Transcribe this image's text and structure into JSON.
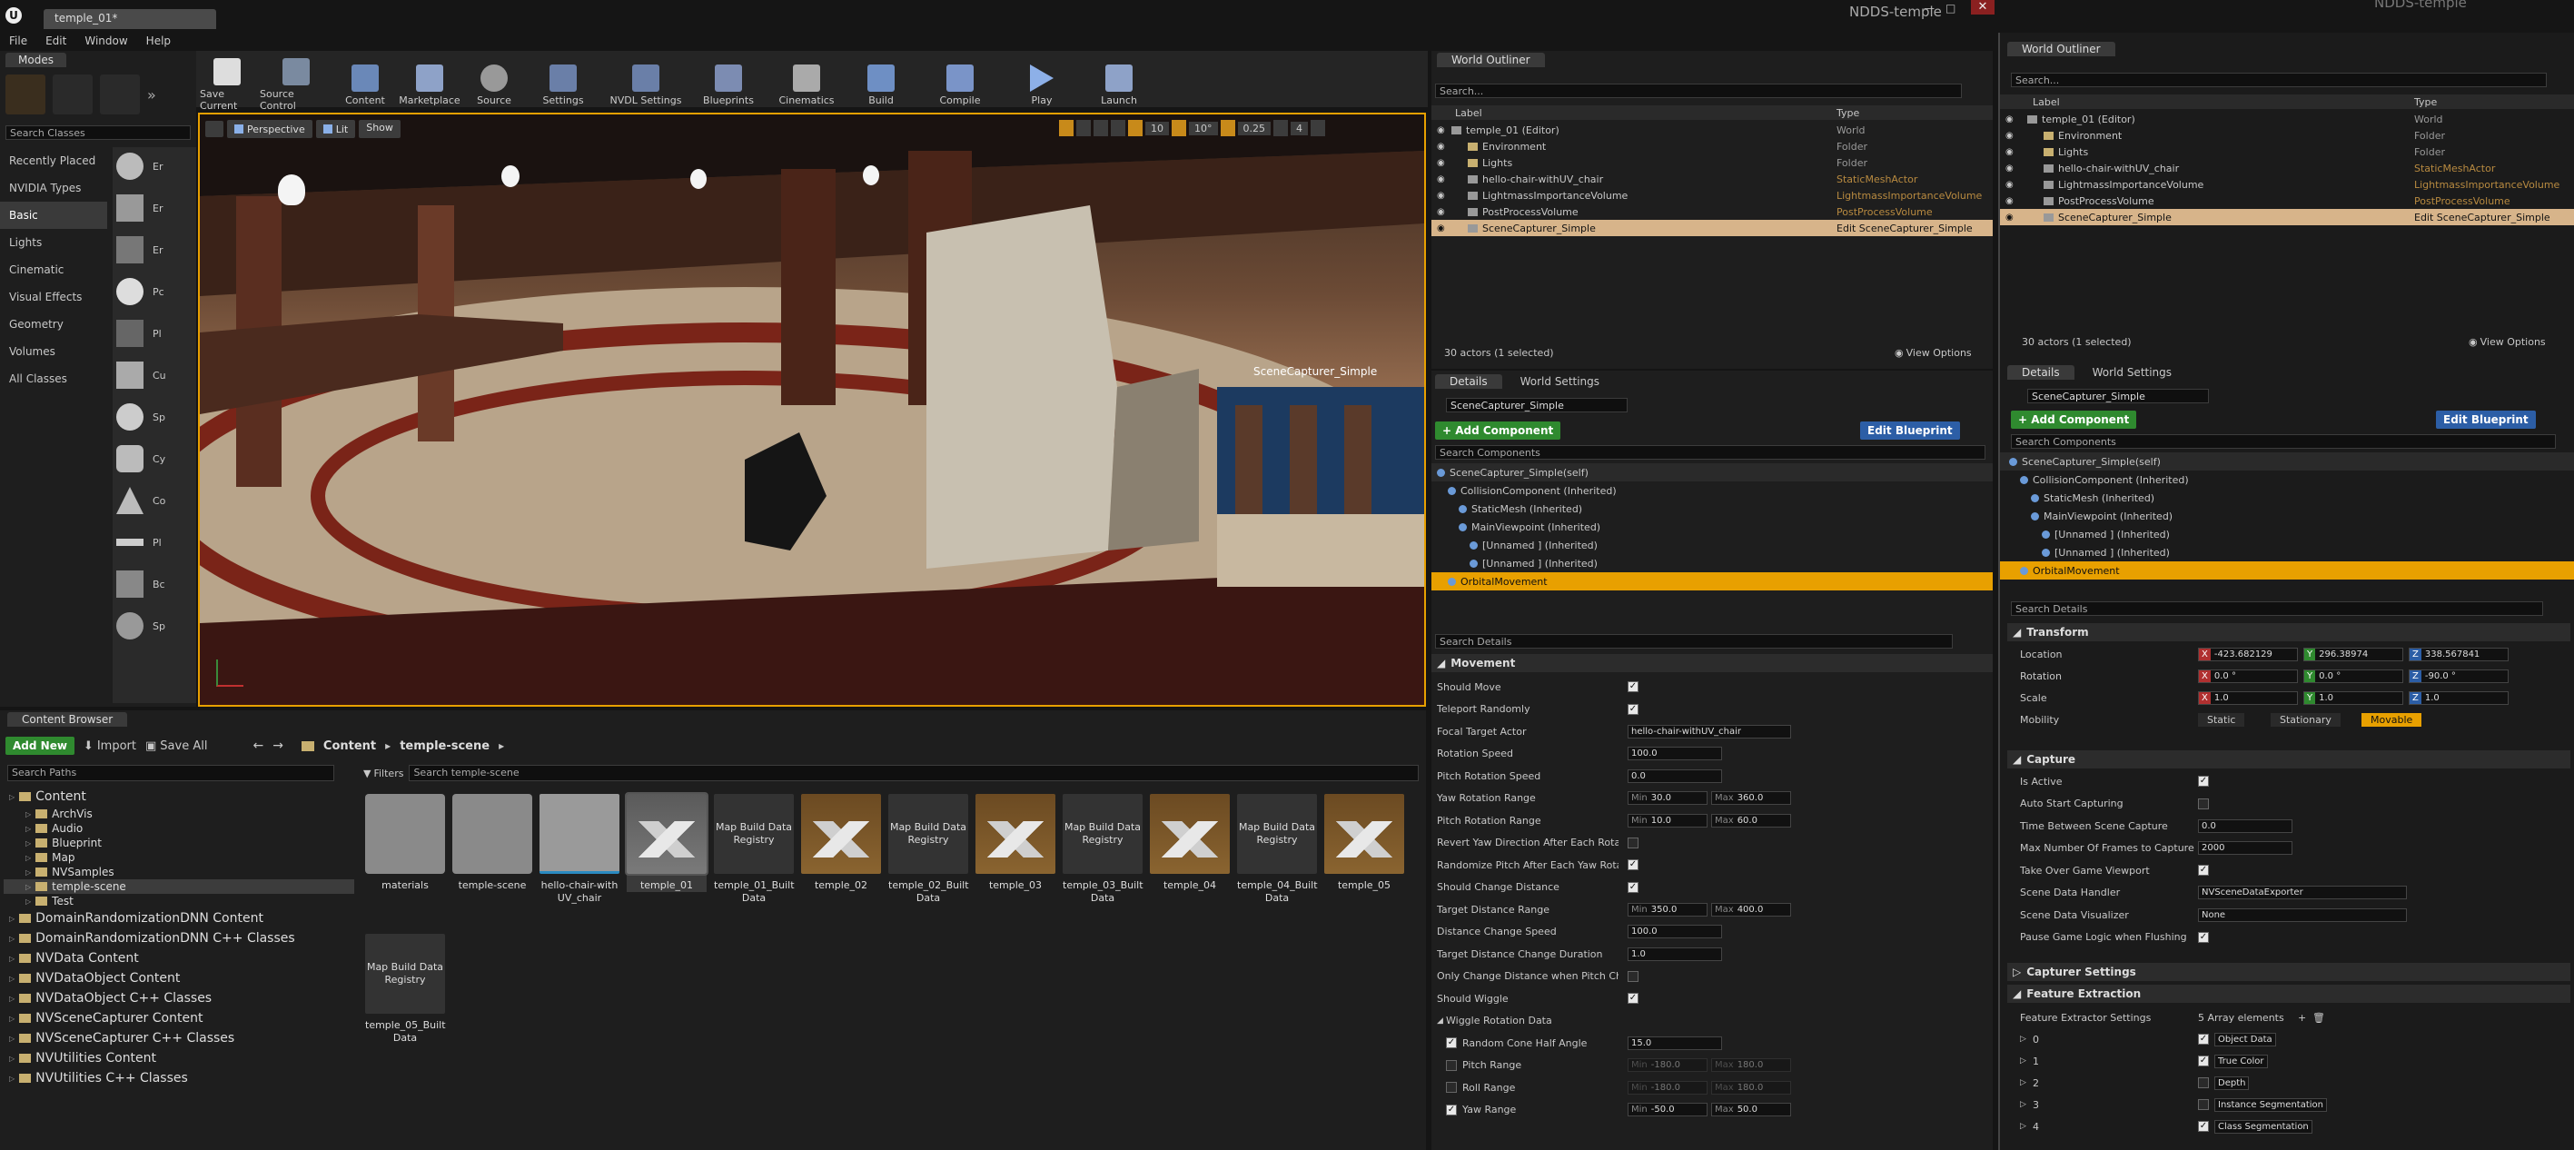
{
  "window": {
    "tab_title": "temple_01*",
    "project_name": "NDDS-temple",
    "project_name_right": "NDDS-temple",
    "menu": [
      "File",
      "Edit",
      "Window",
      "Help"
    ]
  },
  "modes": {
    "title": "Modes",
    "search_placeholder": "Search Classes",
    "categories": [
      "Recently Placed",
      "NVIDIA Types",
      "Basic",
      "Lights",
      "Cinematic",
      "Visual Effects",
      "Geometry",
      "Volumes",
      "All Classes"
    ],
    "item_labels": [
      "Er",
      "Er",
      "Er",
      "Pc",
      "Pl",
      "Cu",
      "Sp",
      "Cy",
      "Co",
      "Pl",
      "Bc",
      "Sp"
    ]
  },
  "toolbar": {
    "buttons": [
      "Save Current",
      "Source Control",
      "Content",
      "Marketplace",
      "Source",
      "Settings",
      "NVDL Settings",
      "Blueprints",
      "Cinematics",
      "Build",
      "Compile",
      "Play",
      "Launch"
    ]
  },
  "viewport": {
    "perspective_label": "Perspective",
    "lit_label": "Lit",
    "show_label": "Show",
    "grid_snap": "10",
    "rot_snap": "10°",
    "scale_snap": "0.25",
    "cam_speed": "4",
    "preview_label": "SceneCapturer_Simple"
  },
  "content_browser": {
    "title": "Content Browser",
    "add_new": "Add New",
    "import": "Import",
    "save_all": "Save All",
    "path": [
      "Content",
      "temple-scene"
    ],
    "search_paths_placeholder": "Search Paths",
    "filters": "Filters",
    "search_placeholder": "Search temple-scene",
    "tree": [
      {
        "label": "Content",
        "depth": 0
      },
      {
        "label": "ArchVis",
        "depth": 1
      },
      {
        "label": "Audio",
        "depth": 1
      },
      {
        "label": "Blueprint",
        "depth": 1
      },
      {
        "label": "Map",
        "depth": 1
      },
      {
        "label": "NVSamples",
        "depth": 1
      },
      {
        "label": "temple-scene",
        "depth": 1
      },
      {
        "label": "Test",
        "depth": 1
      },
      {
        "label": "DomainRandomizationDNN Content",
        "depth": 0
      },
      {
        "label": "DomainRandomizationDNN C++ Classes",
        "depth": 0
      },
      {
        "label": "NVData Content",
        "depth": 0
      },
      {
        "label": "NVDataObject Content",
        "depth": 0
      },
      {
        "label": "NVDataObject C++ Classes",
        "depth": 0
      },
      {
        "label": "NVSceneCapturer Content",
        "depth": 0
      },
      {
        "label": "NVSceneCapturer C++ Classes",
        "depth": 0
      },
      {
        "label": "NVUtilities Content",
        "depth": 0
      },
      {
        "label": "NVUtilities C++ Classes",
        "depth": 0
      }
    ],
    "assets": [
      {
        "label": "materials",
        "kind": "folder"
      },
      {
        "label": "temple-scene",
        "kind": "folder"
      },
      {
        "label": "hello-chair-with UV_chair",
        "kind": "chair"
      },
      {
        "label": "temple_01",
        "kind": "map"
      },
      {
        "label": "temple_01_Built Data",
        "kind": "mbr"
      },
      {
        "label": "temple_02",
        "kind": "map"
      },
      {
        "label": "temple_02_Built Data",
        "kind": "mbr"
      },
      {
        "label": "temple_03",
        "kind": "map"
      },
      {
        "label": "temple_03_Built Data",
        "kind": "mbr"
      },
      {
        "label": "temple_04",
        "kind": "map"
      },
      {
        "label": "temple_04_Built Data",
        "kind": "mbr"
      },
      {
        "label": "temple_05",
        "kind": "map"
      },
      {
        "label": "temple_05_Built Data",
        "kind": "mbr"
      }
    ],
    "mbr_text": "Map Build Data Registry"
  },
  "outliner": {
    "title": "World Outliner",
    "search_placeholder": "Search...",
    "col_label": "Label",
    "col_type": "Type",
    "rows": [
      {
        "label": "temple_01 (Editor)",
        "type": "World",
        "depth": 0
      },
      {
        "label": "Environment",
        "type": "Folder",
        "depth": 1
      },
      {
        "label": "Lights",
        "type": "Folder",
        "depth": 1
      },
      {
        "label": "hello-chair-withUV_chair",
        "type": "StaticMeshActor",
        "depth": 1
      },
      {
        "label": "LightmassImportanceVolume",
        "type": "LightmassImportanceVolume",
        "depth": 1
      },
      {
        "label": "PostProcessVolume",
        "type": "PostProcessVolume",
        "depth": 1
      },
      {
        "label": "SceneCapturer_Simple",
        "type": "Edit SceneCapturer_Simple",
        "depth": 1
      }
    ],
    "actor_count": "30 actors (1 selected)",
    "view_options": "View Options"
  },
  "details": {
    "tab_details": "Details",
    "tab_world": "World Settings",
    "name_value": "SceneCapturer_Simple",
    "add_component": "+ Add Component",
    "edit_blueprint": "Edit Blueprint",
    "search_components": "Search Components",
    "components": [
      {
        "label": "SceneCapturer_Simple(self)",
        "depth": 0
      },
      {
        "label": "CollisionComponent (Inherited)",
        "depth": 1
      },
      {
        "label": "StaticMesh (Inherited)",
        "depth": 2
      },
      {
        "label": "MainViewpoint (Inherited)",
        "depth": 2
      },
      {
        "label": "[Unnamed ] (Inherited)",
        "depth": 3
      },
      {
        "label": "[Unnamed ] (Inherited)",
        "depth": 3
      },
      {
        "label": "OrbitalMovement",
        "depth": 1
      }
    ],
    "search_details": "Search Details",
    "movement_header": "Movement",
    "movement": {
      "should_move": "Should Move",
      "teleport_randomly": "Teleport Randomly",
      "focal_target_actor": "Focal Target Actor",
      "focal_target_value": "hello-chair-withUV_chair",
      "rotation_speed": "Rotation Speed",
      "rotation_speed_value": "100.0",
      "pitch_rotation_speed": "Pitch Rotation Speed",
      "pitch_rotation_speed_value": "0.0",
      "yaw_rotation_range": "Yaw Rotation Range",
      "yaw_min": "30.0",
      "yaw_max": "360.0",
      "pitch_rotation_range": "Pitch Rotation Range",
      "pitch_min": "10.0",
      "pitch_max": "60.0",
      "revert_yaw": "Revert Yaw Direction After Each Rotatio",
      "randomize_pitch": "Randomize Pitch After Each Yaw Rotat",
      "should_change_distance": "Should Change Distance",
      "target_distance_range": "Target Distance Range",
      "dist_min": "350.0",
      "dist_max": "400.0",
      "distance_change_speed": "Distance Change Speed",
      "distance_change_speed_value": "100.0",
      "target_distance_change_duration": "Target Distance Change Duration",
      "target_distance_change_duration_value": "1.0",
      "only_change_distance": "Only Change Distance when Pitch Chan",
      "should_wiggle": "Should Wiggle",
      "wiggle_rotation_data": "Wiggle Rotation Data",
      "random_cone": "Random Cone Half Angle",
      "random_cone_value": "15.0",
      "pitch_range": "Pitch Range",
      "pr_min": "-180.0",
      "pr_max": "180.0",
      "roll_range": "Roll Range",
      "rr_min": "-180.0",
      "rr_max": "180.0",
      "yaw_range": "Yaw Range",
      "yr_min": "-50.0",
      "yr_max": "50.0",
      "min": "Min",
      "max": "Max"
    }
  },
  "right_panel": {
    "outliner_title": "World Outliner",
    "details_title": "Details",
    "world_settings": "World Settings",
    "search_details": "Search Details",
    "transform_header": "Transform",
    "location_label": "Location",
    "location": [
      "-423.682129",
      "296.38974",
      "338.567841"
    ],
    "rotation_label": "Rotation",
    "rotation": [
      "0.0 °",
      "0.0 °",
      "-90.0 °"
    ],
    "scale_label": "Scale",
    "scale": [
      "1.0",
      "1.0",
      "1.0"
    ],
    "mobility_label": "Mobility",
    "mobility_options": [
      "Static",
      "Stationary",
      "Movable"
    ],
    "capture_header": "Capture",
    "is_active": "Is Active",
    "auto_start": "Auto Start Capturing",
    "time_between": "Time Between Scene Capture",
    "time_between_value": "0.0",
    "max_frames": "Max Number Of Frames to Capture",
    "max_frames_value": "2000",
    "take_over": "Take Over Game Viewport",
    "data_handler": "Scene Data Handler",
    "data_handler_value": "NVSceneDataExporter",
    "data_visualizer": "Scene Data Visualizer",
    "data_visualizer_value": "None",
    "pause_game": "Pause Game Logic when Flushing",
    "capturer_settings": "Capturer Settings",
    "feature_extraction_header": "Feature Extraction",
    "feature_extractor_settings": "Feature Extractor Settings",
    "array_elements": "5 Array elements",
    "features": [
      {
        "index": "0",
        "name": "Object Data",
        "checked": true
      },
      {
        "index": "1",
        "name": "True Color",
        "checked": true
      },
      {
        "index": "2",
        "name": "Depth",
        "checked": false
      },
      {
        "index": "3",
        "name": "Instance Segmentation",
        "checked": false
      },
      {
        "index": "4",
        "name": "Class Segmentation",
        "checked": true
      }
    ],
    "x": "X",
    "y": "Y",
    "z": "Z"
  },
  "colors": {
    "accent_orange": "#e8a000",
    "selection_tan": "#d7b48a",
    "green": "#2f8a2f",
    "blue": "#2c5ea6"
  }
}
